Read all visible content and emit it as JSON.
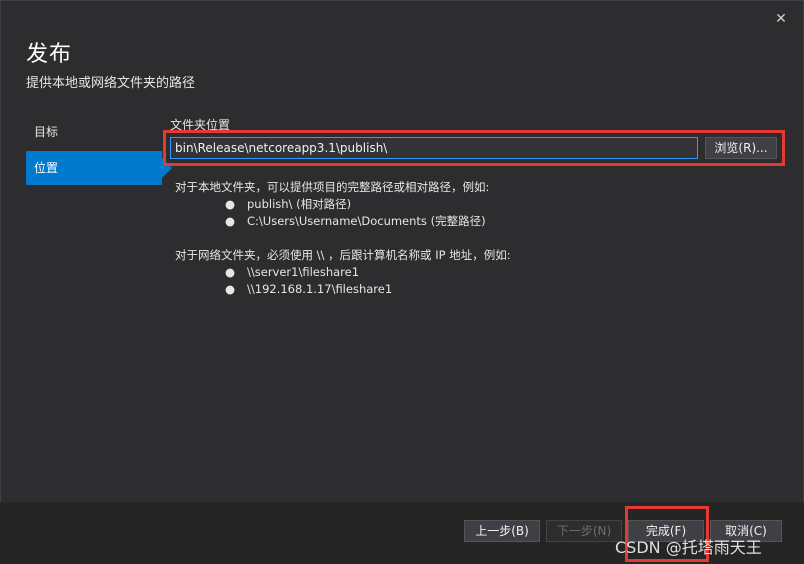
{
  "window": {
    "close_glyph": "✕",
    "title": "发布",
    "subtitle": "提供本地或网络文件夹的路径"
  },
  "sidebar": {
    "items": [
      {
        "label": "目标",
        "active": false
      },
      {
        "label": "位置",
        "active": true
      }
    ]
  },
  "location": {
    "label": "文件夹位置",
    "path_value": "bin\\Release\\netcoreapp3.1\\publish\\",
    "browse_label": "浏览(R)..."
  },
  "help": {
    "local_intro": "对于本地文件夹，可以提供项目的完整路径或相对路径，例如:",
    "local_examples": [
      "publish\\ (相对路径)",
      "C:\\Users\\Username\\Documents (完整路径)"
    ],
    "network_intro": "对于网络文件夹，必须使用 \\\\ ，后跟计算机名称或 IP 地址，例如:",
    "network_examples": [
      "\\\\server1\\fileshare1",
      "\\\\192.168.1.17\\fileshare1"
    ],
    "bullet": "●"
  },
  "footer": {
    "prev_label": "上一步(B)",
    "next_label": "下一步(N)",
    "finish_label": "完成(F)",
    "cancel_label": "取消(C)"
  },
  "watermark": "CSDN @托塔雨天王",
  "colors": {
    "accent": "#007acc",
    "highlight": "#e53935",
    "background": "#2d2d30"
  }
}
